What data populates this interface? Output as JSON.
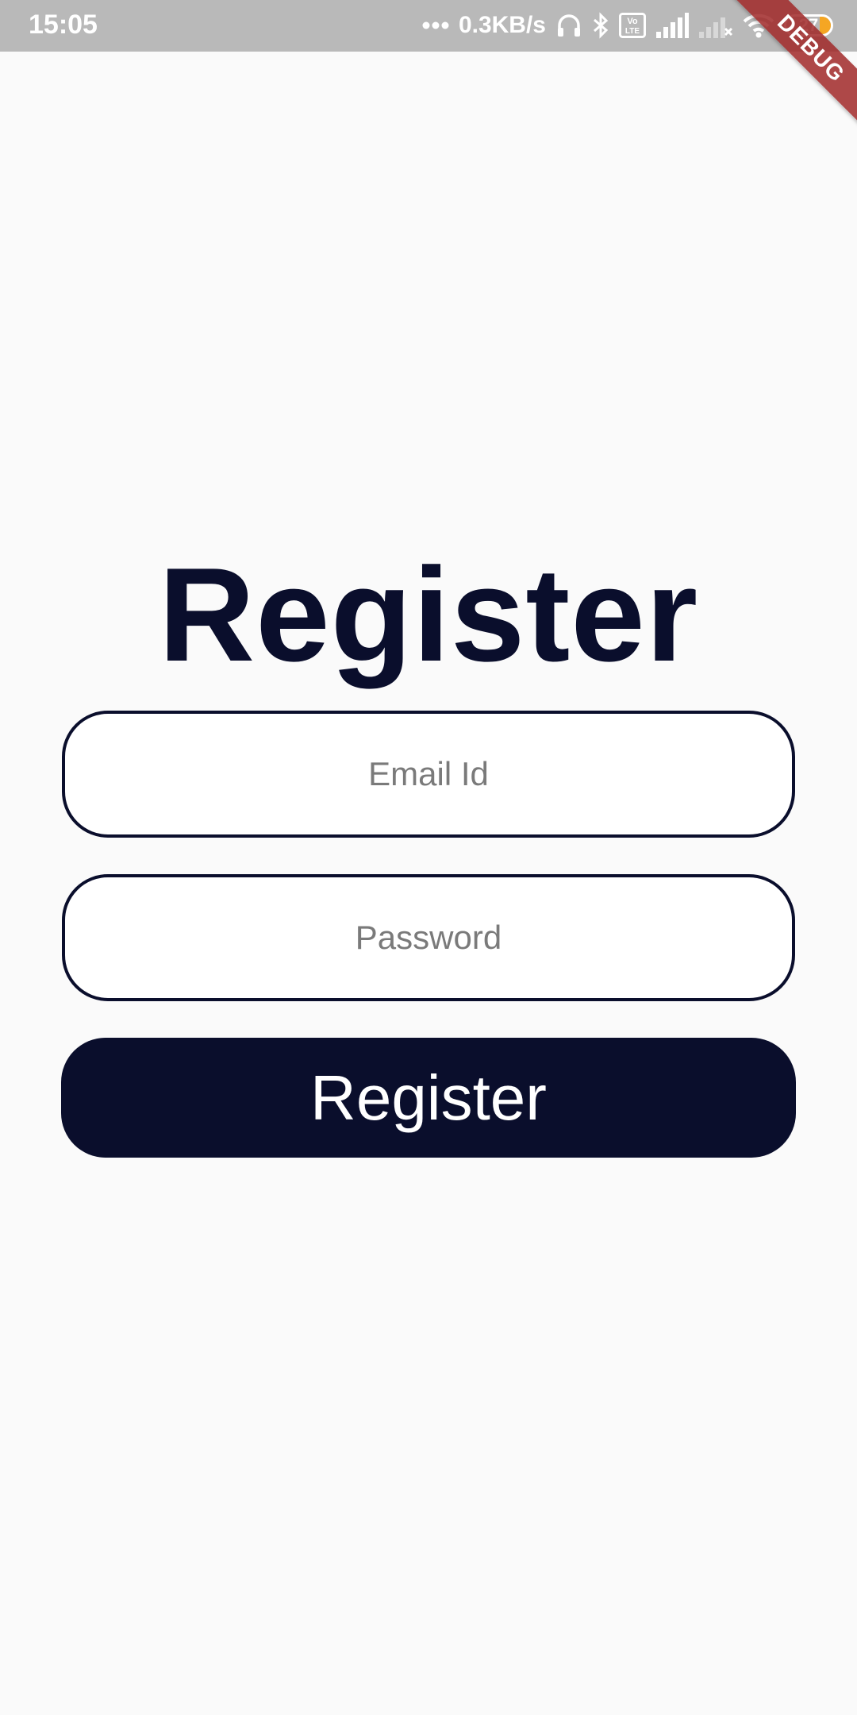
{
  "status_bar": {
    "time": "15:05",
    "network_speed": "0.3KB/s",
    "battery_level": "27",
    "icons": [
      "more-dots-icon",
      "headphones-icon",
      "bluetooth-icon",
      "volte-icon",
      "signal-icon",
      "signal-no-sim-icon",
      "wifi-icon",
      "battery-icon"
    ]
  },
  "debug_banner": "DEBUG",
  "page": {
    "title": "Register"
  },
  "form": {
    "email_placeholder": "Email Id",
    "password_placeholder": "Password",
    "submit_label": "Register"
  },
  "colors": {
    "primary": "#0a0e2c",
    "background": "#fafafa",
    "status_bar": "#b9b9b9",
    "placeholder": "#7a7a7a",
    "battery_accent": "#f5a623",
    "debug_banner": "#a02828"
  }
}
